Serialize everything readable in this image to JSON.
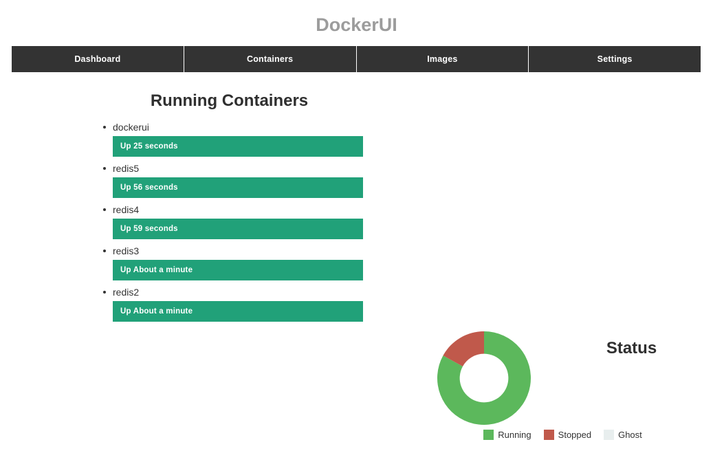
{
  "app": {
    "title": "DockerUI"
  },
  "nav": {
    "tabs": [
      {
        "label": "Dashboard",
        "active": true
      },
      {
        "label": "Containers",
        "active": false
      },
      {
        "label": "Images",
        "active": false
      },
      {
        "label": "Settings",
        "active": false
      }
    ]
  },
  "containers_panel": {
    "heading": "Running Containers",
    "items": [
      {
        "name": "dockerui",
        "status": "Up 25 seconds"
      },
      {
        "name": "redis5",
        "status": "Up 56 seconds"
      },
      {
        "name": "redis4",
        "status": "Up 59 seconds"
      },
      {
        "name": "redis3",
        "status": "Up About a minute"
      },
      {
        "name": "redis2",
        "status": "Up About a minute"
      }
    ],
    "bar_color": "#21a179",
    "bar_track_color": "#f5f5f5"
  },
  "status_panel": {
    "title": "Status"
  },
  "chart_data": {
    "type": "pie",
    "title": "Status",
    "donut": true,
    "inner_radius_ratio": 0.52,
    "start_angle_deg": 0,
    "direction": "counterclockwise",
    "labels": [
      "Running",
      "Stopped",
      "Ghost"
    ],
    "values": [
      83,
      17,
      0
    ],
    "colors": [
      "#5cb85c",
      "#c0594b",
      "#e8eeee"
    ],
    "legend": {
      "position": "bottom",
      "entries": [
        {
          "label": "Running",
          "color": "#5cb85c"
        },
        {
          "label": "Stopped",
          "color": "#c0594b"
        },
        {
          "label": "Ghost",
          "color": "#e8eeee"
        }
      ]
    }
  }
}
